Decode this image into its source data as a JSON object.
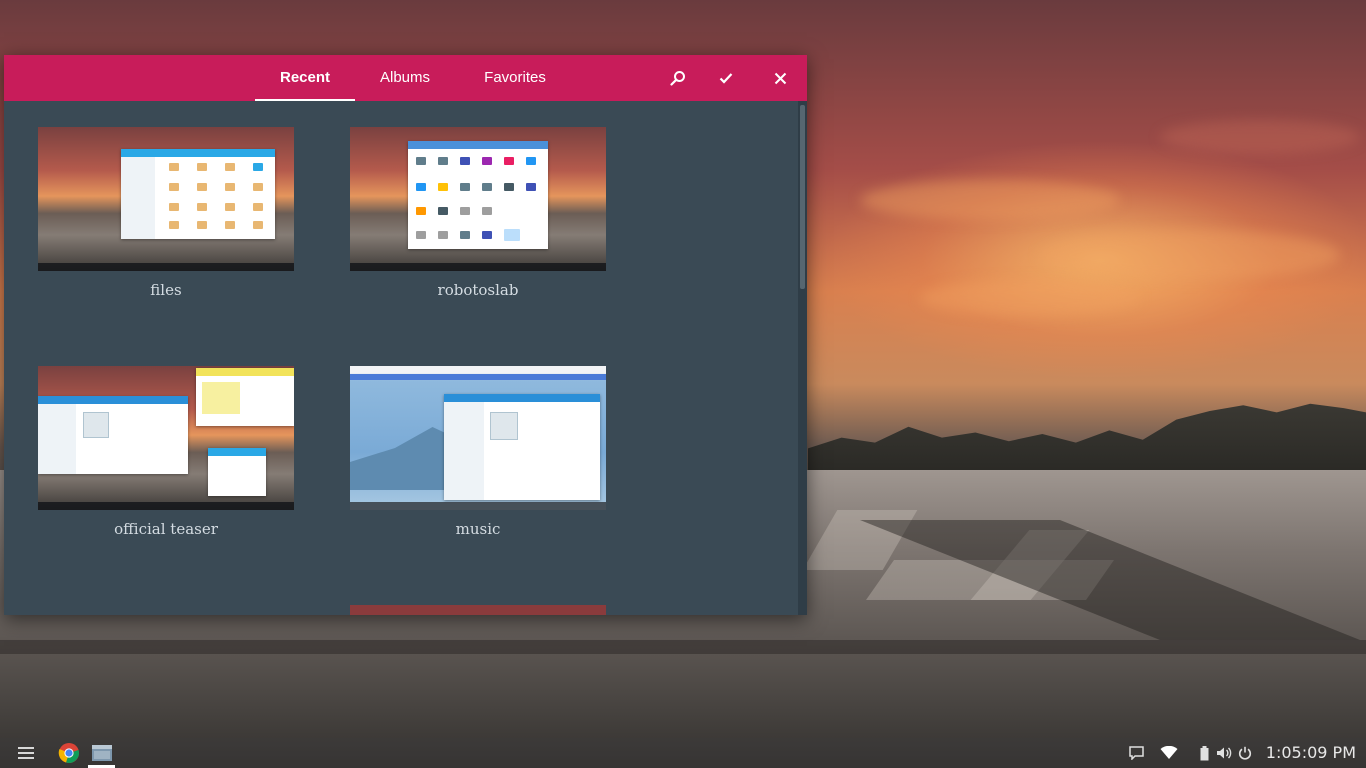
{
  "window": {
    "tabs": [
      {
        "label": "Recent",
        "active": true
      },
      {
        "label": "Albums",
        "active": false
      },
      {
        "label": "Favorites",
        "active": false
      }
    ],
    "actions": {
      "search_icon": "search-icon",
      "confirm_icon": "checkmark-icon",
      "close_icon": "close-icon"
    },
    "accent_color": "#c81c5a",
    "background_color": "#3a4a55",
    "albums": [
      {
        "caption": "files"
      },
      {
        "caption": "robotoslab"
      },
      {
        "caption": "official teaser"
      },
      {
        "caption": "music"
      }
    ]
  },
  "shelf": {
    "launcher_icon": "menu-icon",
    "apps": [
      "chrome-icon",
      "files-app-icon"
    ],
    "tray": [
      "notification-icon",
      "wifi-icon",
      "battery-icon",
      "volume-icon",
      "power-icon"
    ],
    "clock": "1:05:09 PM"
  }
}
